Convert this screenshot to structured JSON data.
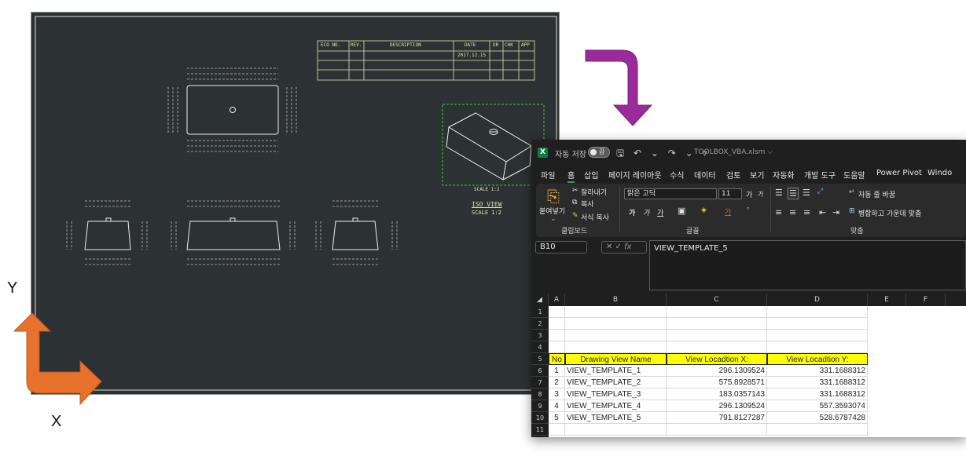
{
  "drawing": {
    "revision_table": {
      "headers": [
        "ECO NO.",
        "REV.",
        "DESCRIPTION",
        "DATE",
        "DR",
        "CHK",
        "APP"
      ],
      "date_value": "2017.12.15"
    },
    "iso_scale_top": "SCALE 1:2",
    "iso_view_title": "ISO VIEW",
    "iso_view_scale": "SCALE 1:2"
  },
  "axes": {
    "y_label": "Y",
    "x_label": "X"
  },
  "colors": {
    "flow_arrow": "#9b2a9b",
    "axis_arrow": "#e8712c",
    "cad_background": "#2c3233",
    "header_fill": "#ffff00"
  },
  "excel": {
    "title": {
      "app_icon": "X",
      "autosave_label": "자동 저장",
      "toggle_label": "끔",
      "quick_icons": "🖫 ↶ ⌄ ↷ ⌄ ▿",
      "filename": "TOOLBOX_VBA.xlsm ⌵"
    },
    "menu": [
      "파일",
      "홈",
      "삽입",
      "페이지 레이아웃",
      "수식",
      "데이터",
      "검토",
      "보기",
      "자동화",
      "개발 도구",
      "도움말",
      "Power Pivot",
      "Windo"
    ],
    "ribbon": {
      "paste": "붙여넣기",
      "cut": "잘라내기",
      "copy": "복사",
      "format_painter": "서식 복사",
      "clipboard_group": "클립보드",
      "font_name": "맑은 고딕",
      "font_size": "11",
      "grow_font": "가",
      "shrink_font": "가",
      "bold": "가",
      "italic": "가",
      "underline": "가",
      "font_group": "글꼴",
      "wrap_text": "자동 줄 바꿈",
      "merge_center": "병합하고 가운데 맞춤",
      "align_group": "맞춤"
    },
    "name_box": "B10",
    "formula_value": "VIEW_TEMPLATE_5",
    "columns": [
      "A",
      "B",
      "C",
      "D",
      "E",
      "F"
    ],
    "rows": [
      "1",
      "2",
      "3",
      "4",
      "5",
      "6",
      "7",
      "8",
      "9",
      "10",
      "11"
    ],
    "table": {
      "headers": [
        "No",
        "Drawing View Name",
        "View Locadtion X:",
        "View Locadtion Y:"
      ],
      "data": [
        [
          "1",
          "VIEW_TEMPLATE_1",
          "296.1309524",
          "331.1688312"
        ],
        [
          "2",
          "VIEW_TEMPLATE_2",
          "575.8928571",
          "331.1688312"
        ],
        [
          "3",
          "VIEW_TEMPLATE_3",
          "183.0357143",
          "331.1688312"
        ],
        [
          "4",
          "VIEW_TEMPLATE_4",
          "296.1309524",
          "557.3593074"
        ],
        [
          "5",
          "VIEW_TEMPLATE_5",
          "791.8127287",
          "528.6787428"
        ]
      ]
    }
  }
}
